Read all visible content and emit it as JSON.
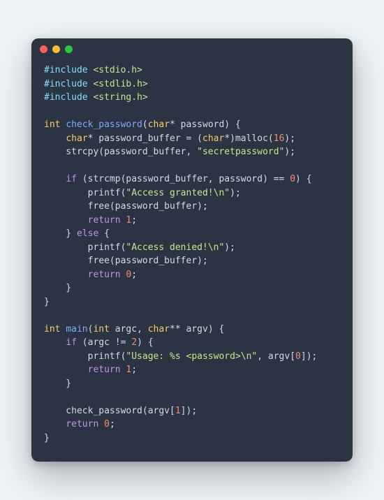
{
  "window": {
    "dots": [
      "close",
      "minimize",
      "zoom"
    ]
  },
  "code": {
    "L01a": "#include ",
    "L01b": "<stdio.h>",
    "L02a": "#include ",
    "L02b": "<stdlib.h>",
    "L03a": "#include ",
    "L03b": "<string.h>",
    "L05a": "int",
    "L05b": " ",
    "L05c": "check_password",
    "L05d": "(",
    "L05e": "char",
    "L05f": "* password) {",
    "L06a": "    ",
    "L06b": "char",
    "L06c": "* password_buffer = (",
    "L06d": "char",
    "L06e": "*)malloc(",
    "L06f": "16",
    "L06g": ");",
    "L07a": "    strcpy(password_buffer, ",
    "L07b": "\"secretpassword\"",
    "L07c": ");",
    "L09a": "    ",
    "L09b": "if",
    "L09c": " (strcmp(password_buffer, password) == ",
    "L09d": "0",
    "L09e": ") {",
    "L10a": "        printf(",
    "L10b": "\"Access granted!\\n\"",
    "L10c": ");",
    "L11a": "        free(password_buffer);",
    "L12a": "        ",
    "L12b": "return",
    "L12c": " ",
    "L12d": "1",
    "L12e": ";",
    "L13a": "    } ",
    "L13b": "else",
    "L13c": " {",
    "L14a": "        printf(",
    "L14b": "\"Access denied!\\n\"",
    "L14c": ");",
    "L15a": "        free(password_buffer);",
    "L16a": "        ",
    "L16b": "return",
    "L16c": " ",
    "L16d": "0",
    "L16e": ";",
    "L17a": "    }",
    "L18a": "}",
    "L20a": "int",
    "L20b": " ",
    "L20c": "main",
    "L20d": "(",
    "L20e": "int",
    "L20f": " argc, ",
    "L20g": "char",
    "L20h": "** argv) {",
    "L21a": "    ",
    "L21b": "if",
    "L21c": " (argc != ",
    "L21d": "2",
    "L21e": ") {",
    "L22a": "        printf(",
    "L22b": "\"Usage: %s <password>\\n\"",
    "L22c": ", argv[",
    "L22d": "0",
    "L22e": "]);",
    "L23a": "        ",
    "L23b": "return",
    "L23c": " ",
    "L23d": "1",
    "L23e": ";",
    "L24a": "    }",
    "L26a": "    check_password(argv[",
    "L26b": "1",
    "L26c": "]);",
    "L27a": "    ",
    "L27b": "return",
    "L27c": " ",
    "L27d": "0",
    "L27e": ";",
    "L28a": "}"
  }
}
